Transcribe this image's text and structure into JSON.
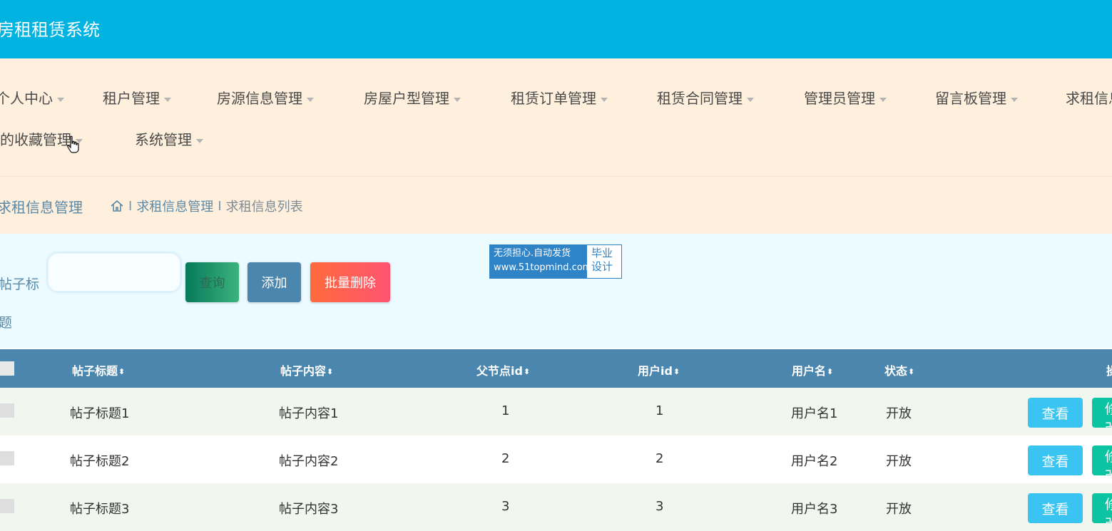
{
  "app": {
    "title": "房租租赁系统"
  },
  "nav": {
    "items": [
      {
        "label": "个人中心"
      },
      {
        "label": "租户管理"
      },
      {
        "label": "房源信息管理"
      },
      {
        "label": "房屋户型管理"
      },
      {
        "label": "租赁订单管理"
      },
      {
        "label": "租赁合同管理"
      },
      {
        "label": "管理员管理"
      },
      {
        "label": "留言板管理"
      },
      {
        "label": "求租信息管理"
      },
      {
        "label": "我的收藏管理"
      },
      {
        "label": "系统管理"
      }
    ]
  },
  "page": {
    "title": "求租信息管理",
    "breadcrumb": {
      "sep": "I",
      "level1": "求租信息管理",
      "level2": "求租信息列表"
    }
  },
  "search": {
    "label": "帖子标题",
    "input_value": "",
    "query_label": "查询",
    "add_label": "添加",
    "batch_delete_label": "批量删除"
  },
  "watermark": {
    "line1": "无须担心.自动发货",
    "url": "www.51topmind.com",
    "right1": "毕业",
    "right2": "设计"
  },
  "table": {
    "sort_glyph": "⬍",
    "columns": [
      "帖子标题",
      "帖子内容",
      "父节点id",
      "用户id",
      "用户名",
      "状态",
      "操作"
    ],
    "rows": [
      {
        "title": "帖子标题1",
        "content": "帖子内容1",
        "parentid": "1",
        "userid": "1",
        "username": "用户名1",
        "status": "开放"
      },
      {
        "title": "帖子标题2",
        "content": "帖子内容2",
        "parentid": "2",
        "userid": "2",
        "username": "用户名2",
        "status": "开放"
      },
      {
        "title": "帖子标题3",
        "content": "帖子内容3",
        "parentid": "3",
        "userid": "3",
        "username": "用户名3",
        "status": "开放"
      }
    ],
    "view_label": "查看",
    "edit_label": "修改"
  },
  "colors": {
    "header": "#00b3e0",
    "nav_bg": "#fff0dd",
    "search_bg": "#ecfbff",
    "table_header": "#4a86ad",
    "view_button": "#39c4f2",
    "edit_button": "#0cc4a2"
  }
}
